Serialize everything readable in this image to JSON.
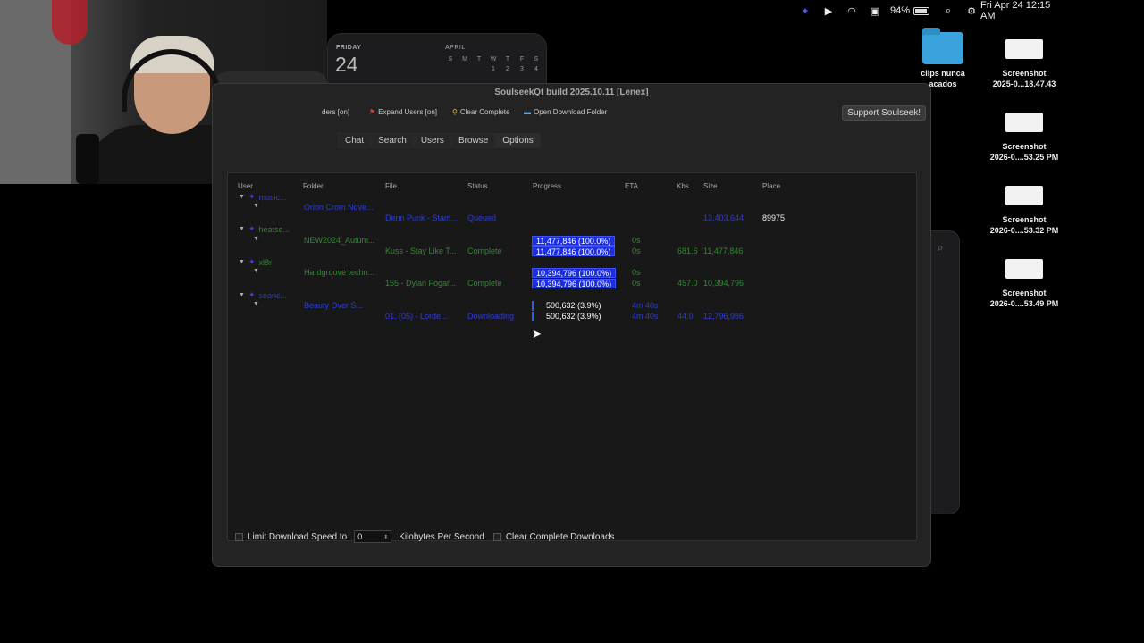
{
  "menubar": {
    "battery": "94%",
    "datetime": "Fri Apr 24  12:15 AM"
  },
  "calendar": {
    "weekday": "FRIDAY",
    "date": "24",
    "month": "APRIL",
    "headers": [
      "S",
      "M",
      "T",
      "W",
      "T",
      "F",
      "S"
    ],
    "days": [
      "",
      "",
      "",
      "1",
      "2",
      "3",
      "4"
    ]
  },
  "desktop": {
    "folder_label": "clips nunca\nacados",
    "screenshots": [
      {
        "line1": "Screenshot",
        "line2": "2025-0...18.47.43"
      },
      {
        "line1": "Screenshot",
        "line2": "2026-0....53.25 PM"
      },
      {
        "line1": "Screenshot",
        "line2": "2026-0....53.32 PM"
      },
      {
        "line1": "Screenshot",
        "line2": "2026-0....53.49 PM"
      }
    ]
  },
  "window": {
    "title": "SoulseekQt build 2025.10.11 [Lenex]",
    "toolbar": {
      "folders": "ders [on]",
      "expand_users": "Expand Users [on]",
      "clear_complete": "Clear Complete",
      "open_download_folder": "Open Download Folder",
      "support": "Support Soulseek!"
    },
    "tabs": [
      "Chat",
      "Search",
      "Users",
      "Browse",
      "Options"
    ],
    "columns": [
      "User",
      "Folder",
      "File",
      "Status",
      "Progress",
      "ETA",
      "Kbs",
      "Size",
      "Place"
    ],
    "groups": [
      {
        "user": "music...",
        "folder": "Orion Crom Nove...",
        "file": "Denn Punk - Stam...",
        "status": "Queued",
        "progress_folder": "",
        "progress_file": "",
        "eta_folder": "",
        "eta_file": "",
        "kbs": "",
        "size": "13,403,644",
        "place": "89975"
      },
      {
        "user": "heatse...",
        "folder": "NEW2024_Autum...",
        "file": "Kuss - Stay Like T...",
        "status": "Complete",
        "progress_folder": "11,477,846 (100.0%)",
        "progress_file": "11,477,846 (100.0%)",
        "eta_folder": "0s",
        "eta_file": "0s",
        "kbs": "681.6",
        "size": "11,477,846",
        "place": ""
      },
      {
        "user": "xl8r",
        "folder": "Hardgroove techn...",
        "file": "155 - Dylan Fogar...",
        "status": "Complete",
        "progress_folder": "10,394,796 (100.0%)",
        "progress_file": "10,394,796 (100.0%)",
        "eta_folder": "0s",
        "eta_file": "0s",
        "kbs": "457.0",
        "size": "10,394,796",
        "place": ""
      },
      {
        "user": "seanc...",
        "folder": "Beauty Over S...",
        "file": "01. (05) - Lorde...",
        "status": "Downloading",
        "progress_folder": "500,632 (3.9%)",
        "progress_file": "500,632 (3.9%)",
        "eta_folder": "4m 40s",
        "eta_file": "4m 40s",
        "kbs": "44.0",
        "size": "12,796,986",
        "place": ""
      }
    ],
    "footer": {
      "limit_label": "Limit Download Speed to",
      "limit_value": "0",
      "unit": "Kilobytes Per Second",
      "clear_label": "Clear Complete Downloads"
    }
  },
  "colors": {
    "link_blue": "#2d3cd8",
    "complete_green": "#2f8a2f",
    "progress_blue": "#1b2ee3"
  }
}
